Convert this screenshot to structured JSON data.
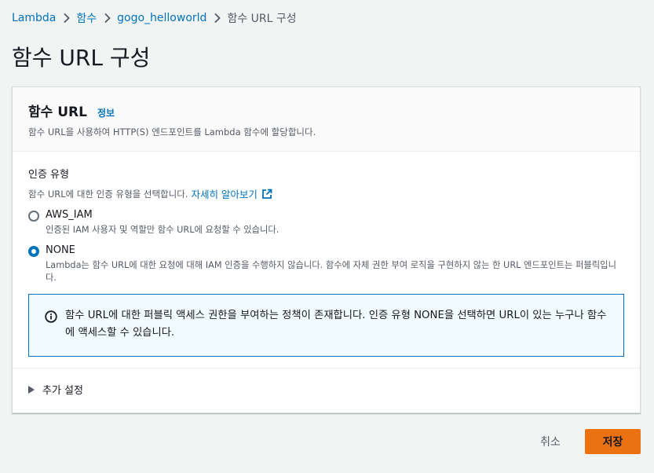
{
  "breadcrumb": {
    "items": [
      "Lambda",
      "함수",
      "gogo_helloworld"
    ],
    "current": "함수 URL 구성"
  },
  "page": {
    "title": "함수 URL 구성"
  },
  "panel": {
    "title": "함수 URL",
    "info": "정보",
    "description": "함수 URL을 사용하여 HTTP(S) 엔드포인트를 Lambda 함수에 할당합니다."
  },
  "auth": {
    "label": "인증 유형",
    "description": "함수 URL에 대한 인증 유형을 선택합니다.",
    "learn_more": "자세히 알아보기",
    "selected": "NONE",
    "options": [
      {
        "label": "AWS_IAM",
        "description": "인증된 IAM 사용자 및 역할만 함수 URL에 요청할 수 있습니다."
      },
      {
        "label": "NONE",
        "description": "Lambda는 함수 URL에 대한 요청에 대해 IAM 인증을 수행하지 않습니다. 함수에 자체 권한 부여 로직을 구현하지 않는 한 URL 엔드포인트는 퍼블릭입니다."
      }
    ]
  },
  "alert": {
    "text": "함수 URL에 대한 퍼블릭 액세스 권한을 부여하는 정책이 존재합니다. 인증 유형 NONE을 선택하면 URL이 있는 누구나 함수에 액세스할 수 있습니다."
  },
  "additional_settings": {
    "label": "추가 설정"
  },
  "actions": {
    "cancel": "취소",
    "save": "저장"
  },
  "colors": {
    "link": "#0073bb",
    "primary": "#ec7211",
    "info_bg": "#f1faff"
  },
  "icons": [
    "chevron-right-icon",
    "external-link-icon",
    "info-icon",
    "caret-right-icon"
  ]
}
